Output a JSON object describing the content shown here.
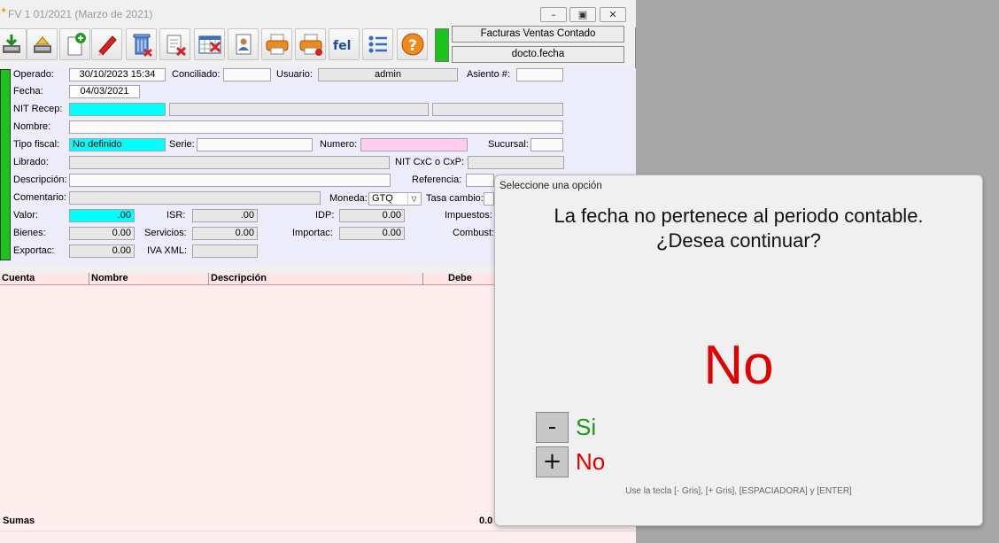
{
  "window": {
    "title": "FV 1 01/2021 (Marzo de 2021)",
    "min_glyph": "–",
    "max_glyph": "▣",
    "close_glyph": "✕"
  },
  "toolbar": {
    "doc_type": "Facturas Ventas Contado",
    "sort_field": "docto.fecha",
    "status_color": "#1ac41a",
    "icons": [
      "download-icon",
      "upload-icon",
      "new-doc-icon",
      "edit-icon",
      "delete-icon",
      "cancel-doc-icon",
      "calendar-delete-icon",
      "contact-icon",
      "print-icon",
      "print-alt-icon",
      "fel-icon",
      "list-icon",
      "help-icon"
    ],
    "fel_label": "fel",
    "help_glyph": "?"
  },
  "form": {
    "operado_label": "Operado:",
    "operado_value": "30/10/2023 15:34",
    "conciliado_label": "Conciliado:",
    "conciliado_value": "",
    "usuario_label": "Usuario:",
    "usuario_value": "admin",
    "asiento_label": "Asiento #:",
    "asiento_value": "",
    "fecha_label": "Fecha:",
    "fecha_value": "04/03/2021",
    "nit_label": "NIT Recep:",
    "nit_value": "",
    "nombre_label": "Nombre:",
    "nombre_value": "",
    "tipo_fiscal_label": "Tipo fiscal:",
    "tipo_fiscal_value": "No definido",
    "serie_label": "Serie:",
    "serie_value": "",
    "numero_label": "Numero:",
    "numero_value": "",
    "sucursal_label": "Sucursal:",
    "sucursal_value": "",
    "librado_label": "Librado:",
    "librado_value": "",
    "nit_cxc_label": "NIT CxC o CxP:",
    "nit_cxc_value": "",
    "descripcion_label": "Descripción:",
    "descripcion_value": "",
    "referencia_label": "Referencia:",
    "comentario_label": "Comentario:",
    "comentario_value": "",
    "moneda_label": "Moneda:",
    "moneda_value": "GTQ",
    "tasa_label": "Tasa cambio:",
    "valor_label": "Valor:",
    "valor_value": ".00",
    "isr_label": "ISR:",
    "isr_value": ".00",
    "idp_label": "IDP:",
    "idp_value": "0.00",
    "impuestos_label": "Impuestos:",
    "bienes_label": "Bienes:",
    "bienes_value": "0.00",
    "servicios_label": "Servicios:",
    "servicios_value": "0.00",
    "importac_label": "Importac:",
    "importac_value": "0.00",
    "combust_label": "Combust:",
    "exportac_label": "Exportac:",
    "exportac_value": "0.00",
    "iva_xml_label": "IVA XML:",
    "iva_xml_value": ""
  },
  "grid": {
    "columns": [
      "Cuenta",
      "Nombre",
      "Descripción",
      "Debe"
    ],
    "sums_label": "Sumas",
    "sums_value": "0.0"
  },
  "dialog": {
    "title": "Seleccione una opción",
    "message_line1": "La fecha no pertenece al periodo contable.",
    "message_line2": "¿Desea continuar?",
    "selected": "No",
    "option_minus_key": "-",
    "option_minus_label": "Si",
    "option_plus_key": "+",
    "option_plus_label": "No",
    "hint": "Use la tecla [- Gris], [+ Gris], [ESPACIADORA] y [ENTER]",
    "color_yes": "#1a9a1a",
    "color_no": "#e00000"
  }
}
